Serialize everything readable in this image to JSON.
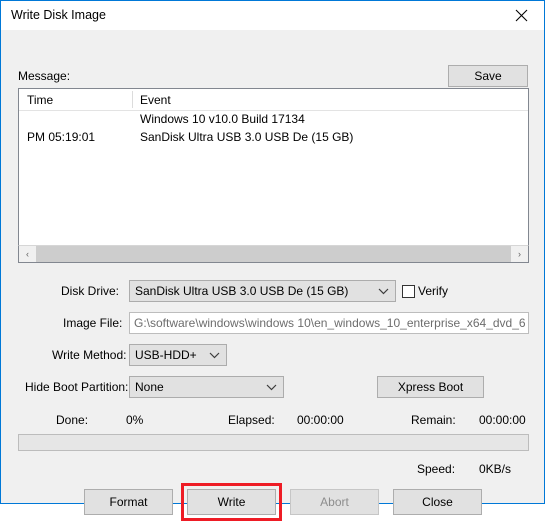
{
  "window": {
    "title": "Write Disk Image",
    "close_icon": "close-icon"
  },
  "message": {
    "label": "Message:",
    "save_label": "Save",
    "columns": [
      "Time",
      "Event"
    ],
    "rows": [
      {
        "time": "",
        "event": "Windows 10 v10.0 Build 17134"
      },
      {
        "time": "PM 05:19:01",
        "event": "SanDisk Ultra USB 3.0 USB De (15 GB)"
      }
    ],
    "scrollbar": {
      "left_arrow": "‹",
      "right_arrow": "›"
    }
  },
  "form": {
    "disk_drive_label": "Disk Drive:",
    "disk_drive_value": "SanDisk Ultra USB 3.0 USB De (15 GB)",
    "verify_label": "Verify",
    "verify_checked": false,
    "image_file_label": "Image File:",
    "image_file_value": "G:\\software\\windows\\windows 10\\en_windows_10_enterprise_x64_dvd_6",
    "write_method_label": "Write Method:",
    "write_method_value": "USB-HDD+",
    "hide_boot_label": "Hide Boot Partition:",
    "hide_boot_value": "None",
    "xpress_boot_label": "Xpress Boot"
  },
  "progress": {
    "done_label": "Done:",
    "done_value": "0%",
    "elapsed_label": "Elapsed:",
    "elapsed_value": "00:00:00",
    "remain_label": "Remain:",
    "remain_value": "00:00:00",
    "speed_label": "Speed:",
    "speed_value": "0KB/s",
    "percent": 0
  },
  "buttons": {
    "format": "Format",
    "write": "Write",
    "abort": "Abort",
    "close": "Close"
  },
  "colors": {
    "window_border": "#0078d7",
    "dialog_bg": "#f0f0f0",
    "highlight": "#ee1c25"
  }
}
